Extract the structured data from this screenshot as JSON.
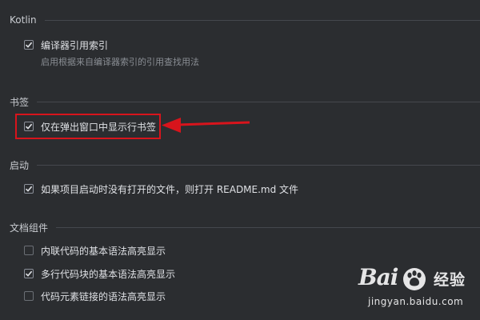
{
  "sections": {
    "kotlin": {
      "title": "Kotlin",
      "option": {
        "label": "编译器引用索引",
        "checked": true
      },
      "hint": "启用根据来自编译器索引的引用查找用法"
    },
    "bookmarks": {
      "title": "书签",
      "option": {
        "label": "仅在弹出窗口中显示行书签",
        "checked": true
      }
    },
    "startup": {
      "title": "启动",
      "option": {
        "label": "如果项目启动时没有打开的文件，则打开 README.md 文件",
        "checked": true
      }
    },
    "doc_components": {
      "title": "文档组件",
      "options": [
        {
          "label": "内联代码的基本语法高亮显示",
          "checked": false
        },
        {
          "label": "多行代码块的基本语法高亮显示",
          "checked": true
        },
        {
          "label": "代码元素链接的语法高亮显示",
          "checked": false
        }
      ]
    }
  },
  "annotation": {
    "color": "#d8141c"
  },
  "watermark": {
    "brand": "Bai",
    "brand_suffix": "经验",
    "url": "jingyan.baidu.com"
  },
  "icons": {
    "check": "checkmark-icon",
    "arrow": "arrow-left-icon",
    "paw": "baidu-paw-icon"
  }
}
